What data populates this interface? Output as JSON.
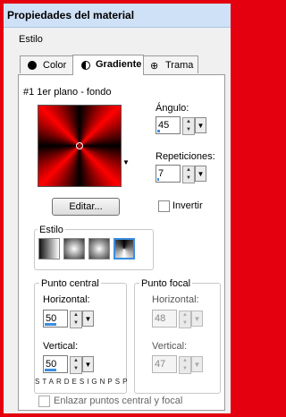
{
  "window": {
    "title": "Propiedades del material"
  },
  "section_label": "Estilo",
  "tabs": [
    {
      "label": "Color",
      "icon": "filled-circle-icon"
    },
    {
      "label": "Gradiente",
      "icon": "half-circle-icon"
    },
    {
      "label": "Trama",
      "icon": "pattern-icon"
    }
  ],
  "gradient_name": "#1 1er plano - fondo",
  "angle": {
    "label": "Ángulo:",
    "value": "45",
    "level": 0.125
  },
  "repetitions": {
    "label": "Repeticiones:",
    "value": "7",
    "level": 0.07
  },
  "edit_button": "Editar...",
  "invert": {
    "label": "Invertir",
    "checked": false
  },
  "style_group": {
    "label": "Estilo",
    "selected_index": 3
  },
  "center_point": {
    "label": "Punto central",
    "horizontal": {
      "label": "Horizontal:",
      "value": "50",
      "level": 0.5
    },
    "vertical": {
      "label": "Vertical:",
      "value": "50",
      "level": 0.5
    }
  },
  "focal_point": {
    "label": "Punto focal",
    "horizontal": {
      "label": "Horizontal:",
      "value": "48",
      "level": 0.48
    },
    "vertical": {
      "label": "Vertical:",
      "value": "47",
      "level": 0.47
    }
  },
  "link_points": {
    "label": "Enlazar puntos central y focal",
    "checked": false
  },
  "watermark": "STARDESIGNPSP",
  "colors": {
    "accent": "#3b8de0",
    "frame": "#e4000f"
  }
}
